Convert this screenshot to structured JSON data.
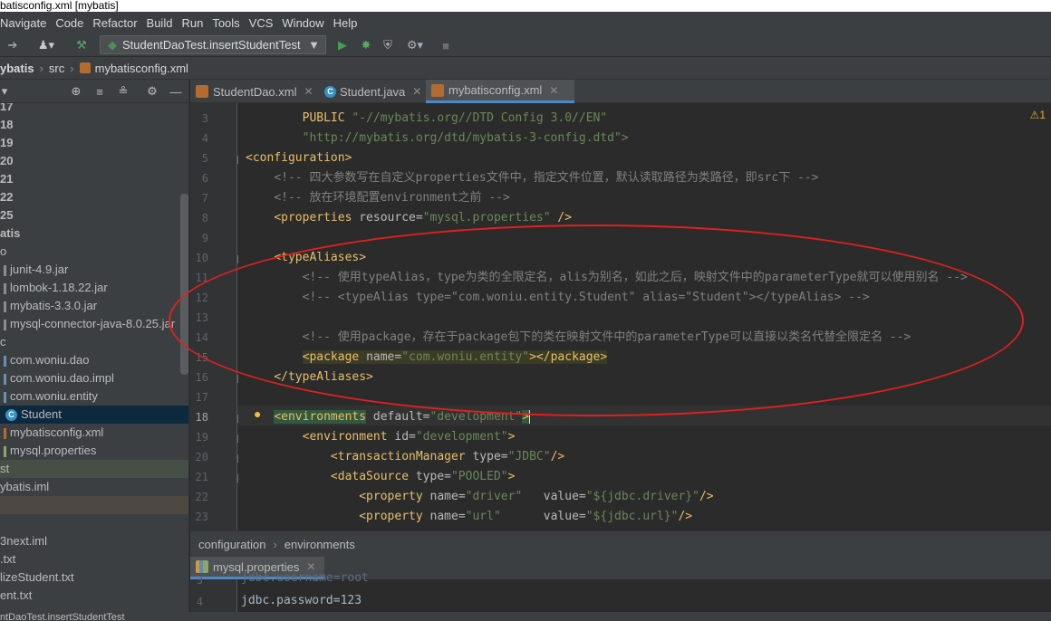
{
  "window_title": "batisconfig.xml [mybatis]",
  "menu": [
    "Navigate",
    "Code",
    "Refactor",
    "Build",
    "Run",
    "Tools",
    "VCS",
    "Window",
    "Help"
  ],
  "toolbar": {
    "run_config": "StudentDaoTest.insertStudentTest",
    "icons": [
      "back-arrow-icon",
      "user-icon",
      "build-hammer-icon",
      "run-icon",
      "debug-icon",
      "coverage-icon",
      "profile-icon",
      "stop-icon"
    ]
  },
  "breadcrumb": [
    "ybatis",
    "src",
    "mybatisconfig.xml"
  ],
  "project_tree": [
    {
      "label": "17",
      "style": "bold"
    },
    {
      "label": "18",
      "style": "bold"
    },
    {
      "label": "19",
      "style": "bold"
    },
    {
      "label": "20",
      "style": "bold"
    },
    {
      "label": "21",
      "style": "bold"
    },
    {
      "label": "22",
      "style": "bold"
    },
    {
      "label": "25",
      "style": "bold"
    },
    {
      "label": "atis",
      "style": "bold"
    },
    {
      "label": "o",
      "style": "plain"
    },
    {
      "label": "junit-4.9.jar",
      "style": "plain"
    },
    {
      "label": "lombok-1.18.22.jar",
      "style": "plain"
    },
    {
      "label": "mybatis-3.3.0.jar",
      "style": "plain"
    },
    {
      "label": "mysql-connector-java-8.0.25.jar",
      "style": "plain"
    },
    {
      "label": "c",
      "style": "plain"
    },
    {
      "label": "com.woniu.dao",
      "style": "plain"
    },
    {
      "label": "com.woniu.dao.impl",
      "style": "plain"
    },
    {
      "label": "com.woniu.entity",
      "style": "plain"
    },
    {
      "label": "Student",
      "style": "selected"
    },
    {
      "label": "mybatisconfig.xml",
      "style": "plain"
    },
    {
      "label": "mysql.properties",
      "style": "plain"
    },
    {
      "label": "st",
      "style": "dim"
    },
    {
      "label": "ybatis.iml",
      "style": "plain"
    },
    {
      "label": "",
      "style": "dim2"
    },
    {
      "label": "",
      "style": "plain"
    },
    {
      "label": "3next.iml",
      "style": "plain"
    },
    {
      "label": ".txt",
      "style": "plain"
    },
    {
      "label": "lizeStudent.txt",
      "style": "plain"
    },
    {
      "label": "ent.txt",
      "style": "plain"
    }
  ],
  "tabs": [
    {
      "label": "StudentDao.xml",
      "icon": "xml-file-icon",
      "active": false
    },
    {
      "label": "Student.java",
      "icon": "class-icon",
      "active": false
    },
    {
      "label": "mybatisconfig.xml",
      "icon": "xml-file-icon",
      "active": true
    }
  ],
  "code": {
    "lines": [
      "3",
      "4",
      "5",
      "6",
      "7",
      "8",
      "9",
      "10",
      "11",
      "12",
      "13",
      "14",
      "15",
      "16",
      "17",
      "18",
      "19",
      "20",
      "21",
      "22",
      "23"
    ],
    "current_line": "18",
    "l3_kw": "PUBLIC",
    "l3_str": "\"-//mybatis.org//DTD Config 3.0//EN\"",
    "l4_str": "\"http://mybatis.org/dtd/mybatis-3-config.dtd\">",
    "l5_tag": "<configuration>",
    "l6_comment": "<!-- 四大参数写在自定义properties文件中，指定文件位置，默认读取路径为类路径，即src下 -->",
    "l7_comment": "<!-- 放在环境配置environment之前 -->",
    "l8_tag": "<properties",
    "l8_attr": " resource=",
    "l8_val": "\"mysql.properties\"",
    "l8_end": " />",
    "l10_tag": "<typeAliases>",
    "l11_comment": "<!-- 使用typeAlias，type为类的全限定名，alis为别名，如此之后，映射文件中的parameterType就可以使用别名 -->",
    "l12_comment": "<!-- <typeAlias type=\"com.woniu.entity.Student\" alias=\"Student\"></typeAlias> -->",
    "l14_comment": "<!-- 使用package，存在于package包下的类在映射文件中的parameterType可以直接以类名代替全限定名 -->",
    "l15_tag": "<package",
    "l15_attr": " name=",
    "l15_val": "\"com.woniu.entity\"",
    "l15_end": "></package>",
    "l16_tag": "</typeAliases>",
    "l18_tag": "<environments",
    "l18_attr": " default=",
    "l18_val": "\"development\"",
    "l18_end": ">",
    "l19_tag": "<environment",
    "l19_attr": " id=",
    "l19_val": "\"development\"",
    "l19_end": ">",
    "l20_tag": "<transactionManager",
    "l20_attr": " type=",
    "l20_val": "\"JDBC\"",
    "l20_end": "/>",
    "l21_tag": "<dataSource",
    "l21_attr": " type=",
    "l21_val": "\"POOLED\"",
    "l21_end": ">",
    "l22_tag": "<property",
    "l22_attr": " name=",
    "l22_val": "\"driver\"",
    "l22_attr2": "   value=",
    "l22_val2": "\"${jdbc.driver}\"",
    "l22_end": "/>",
    "l23_tag": "<property",
    "l23_attr": " name=",
    "l23_val": "\"url\"",
    "l23_attr2": "      value=",
    "l23_val2": "\"${jdbc.url}\"",
    "l23_end": "/>"
  },
  "warnings_count": "1",
  "structure_path": [
    "configuration",
    "environments"
  ],
  "bottom_tab": "mysql.properties",
  "bottom_code": {
    "line_a": "3",
    "line_b": "4",
    "text_a": "jdbc.username=root",
    "text_b": "jdbc.password=123"
  },
  "status_text": "ntDaoTest.insertStudentTest",
  "colors": {
    "accent": "#4a88c7",
    "circle": "#e02020",
    "tag": "#e8bf6a",
    "string": "#6a8759",
    "comment": "#808080"
  }
}
